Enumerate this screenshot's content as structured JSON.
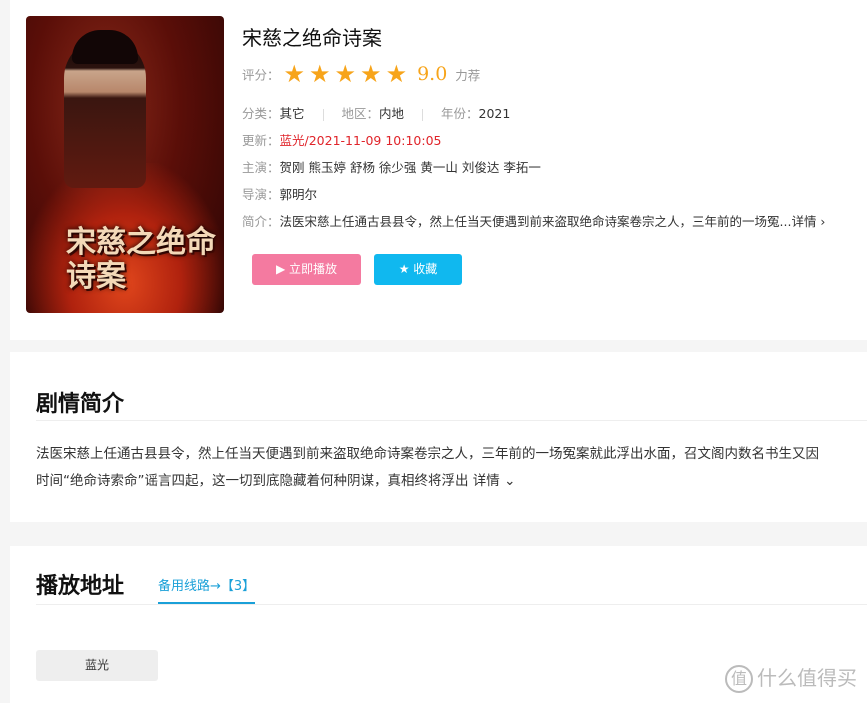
{
  "movie": {
    "title": "宋慈之绝命诗案",
    "poster_title": "宋慈之绝命诗案",
    "rating_label": "评分：",
    "stars": 5,
    "score": "9.0",
    "score_suffix": "力荐",
    "category_label": "分类：",
    "category": "其它",
    "region_label": "地区：",
    "region": "内地",
    "year_label": "年份：",
    "year": "2021",
    "update_label": "更新：",
    "update_value": "蓝光/2021-11-09 10:10:05",
    "cast_label": "主演：",
    "cast": "贺刚 熊玉婷 舒杨 徐少强 黄一山 刘俊达 李拓一",
    "director_label": "导演：",
    "director": "郭明尔",
    "summary_label": "简介：",
    "summary": "法医宋慈上任通古县县令，然上任当天便遇到前来盗取绝命诗案卷宗之人，三年前的一场冤...",
    "summary_more": "详情 ›"
  },
  "buttons": {
    "play": "▶ 立即播放",
    "favorite": "★ 收藏"
  },
  "plot": {
    "heading": "剧情简介",
    "line1": "法医宋慈上任通古县县令，然上任当天便遇到前来盗取绝命诗案卷宗之人，三年前的一场冤案就此浮出水面，召文阁内数名书生又因",
    "line2": "时间“绝命诗索命”谣言四起，这一切到底隐藏着何种阴谋，真相终将浮出",
    "more": "详情 ⌄"
  },
  "play": {
    "heading": "播放地址",
    "tab": "备用线路→【3】",
    "episodes": [
      "蓝光"
    ]
  },
  "watermark": {
    "badge": "值",
    "text": "什么值得买"
  },
  "colors": {
    "accent_red": "#e0242a",
    "star": "#f7a41a",
    "play_button": "#f47aa0",
    "fav_button": "#10b8ef",
    "tab_blue": "#1aa0d8"
  }
}
